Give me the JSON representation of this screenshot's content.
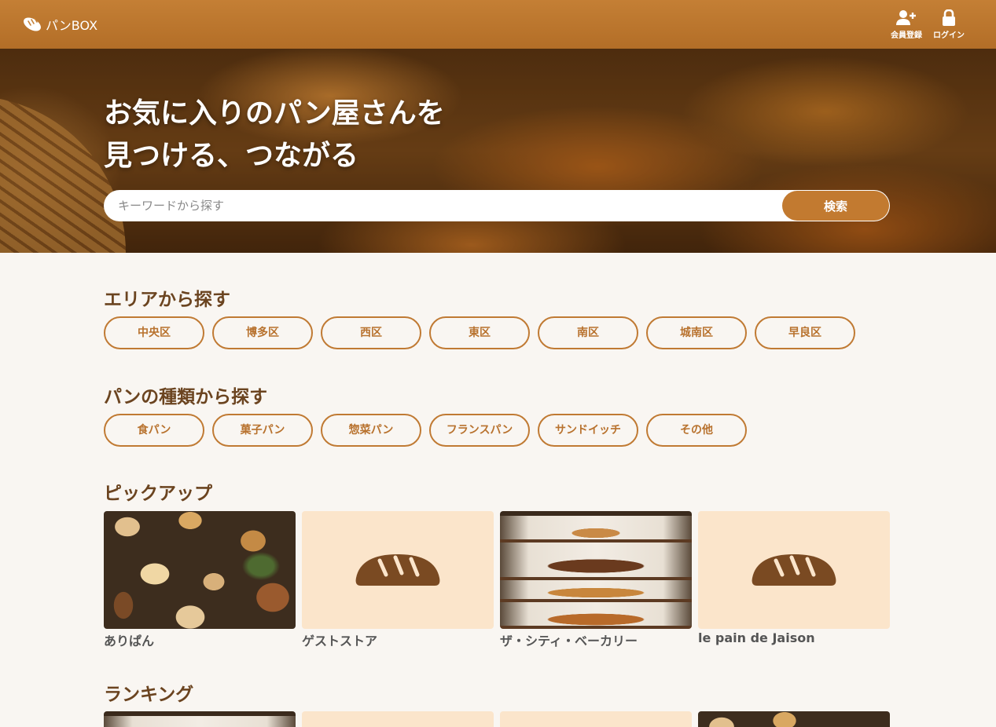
{
  "header": {
    "logo_text": "パンBOX",
    "logo_icon": "bread-icon",
    "nav": [
      {
        "label": "会員登録",
        "icon": "user-plus-icon"
      },
      {
        "label": "ログイン",
        "icon": "lock-icon"
      }
    ]
  },
  "hero": {
    "title_line1": "お気に入りのパン屋さんを",
    "title_line2": "見つける、つながる",
    "search_placeholder": "キーワードから探す",
    "search_button": "検索"
  },
  "area": {
    "title": "エリアから探す",
    "items": [
      "中央区",
      "博多区",
      "西区",
      "東区",
      "南区",
      "城南区",
      "早良区"
    ]
  },
  "bread_types": {
    "title": "パンの種類から探す",
    "items": [
      "食パン",
      "菓子パン",
      "惣菜パン",
      "フランスパン",
      "サンドイッチ",
      "その他"
    ]
  },
  "pickup": {
    "title": "ピックアップ",
    "items": [
      {
        "name": "ありぱん",
        "image": "photo-breads"
      },
      {
        "name": "ゲストストア",
        "image": "placeholder-bread-icon"
      },
      {
        "name": "ザ・シティ・ベーカリー",
        "image": "photo-shop"
      },
      {
        "name": "le pain de Jaison",
        "image": "placeholder-bread-icon"
      }
    ]
  },
  "ranking": {
    "title": "ランキング"
  },
  "colors": {
    "header_bg": "#c47f35",
    "accent": "#c27a30",
    "chip_border": "#c07a33",
    "placeholder_bg": "#fbe5cb",
    "bread_icon": "#7a4a22"
  }
}
